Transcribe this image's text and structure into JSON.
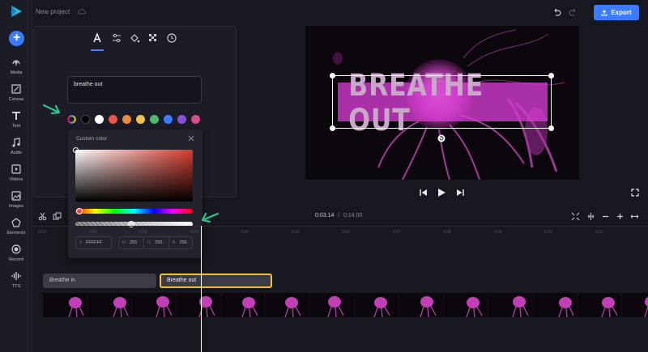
{
  "header": {
    "project_title": "New project",
    "export_label": "Export"
  },
  "rail": {
    "items": [
      {
        "label": "Media",
        "icon": "media-icon"
      },
      {
        "label": "Canvas",
        "icon": "canvas-icon"
      },
      {
        "label": "Text",
        "icon": "text-icon"
      },
      {
        "label": "Audio",
        "icon": "audio-icon"
      },
      {
        "label": "Videos",
        "icon": "videos-icon"
      },
      {
        "label": "Images",
        "icon": "images-icon"
      },
      {
        "label": "Elements",
        "icon": "elements-icon"
      },
      {
        "label": "Record",
        "icon": "record-icon"
      },
      {
        "label": "TTS",
        "icon": "tts-icon"
      }
    ]
  },
  "text_panel": {
    "tabs": [
      "text-tab",
      "adjust-tab",
      "fill-tab",
      "transparency-tab",
      "timing-tab"
    ],
    "text_value": "breathe out",
    "swatches": [
      "#000000",
      "#ffffff",
      "#e8554e",
      "#ea8a3e",
      "#f2c14e",
      "#4fb870",
      "#3a7bff",
      "#8a4fd8",
      "#d14f8a"
    ]
  },
  "color_picker": {
    "title": "Custom color",
    "hex_label": "#",
    "hex_value": "FFFFFF",
    "r_label": "R",
    "r_value": "255",
    "g_label": "G",
    "g_value": "255",
    "b_label": "B",
    "b_value": "255",
    "hue_color": "#e34a3a"
  },
  "preview": {
    "headline": "BREATHE OUT",
    "box_color": "#d63cd2"
  },
  "timeline": {
    "current_time": "0:03.14",
    "separator": "/",
    "total_time": "0:14.00",
    "ticks": [
      "0:00",
      "0:01",
      "0:02",
      "0:03",
      "0:04",
      "0:05",
      "0:06",
      "0:07",
      "0:08",
      "0:09",
      "0:10",
      "0:11"
    ],
    "clips": [
      "Breathe in",
      "Breathe out"
    ]
  },
  "colors": {
    "accent": "#3a7bff",
    "selection": "#f0c030",
    "arrow": "#2bc48a"
  }
}
